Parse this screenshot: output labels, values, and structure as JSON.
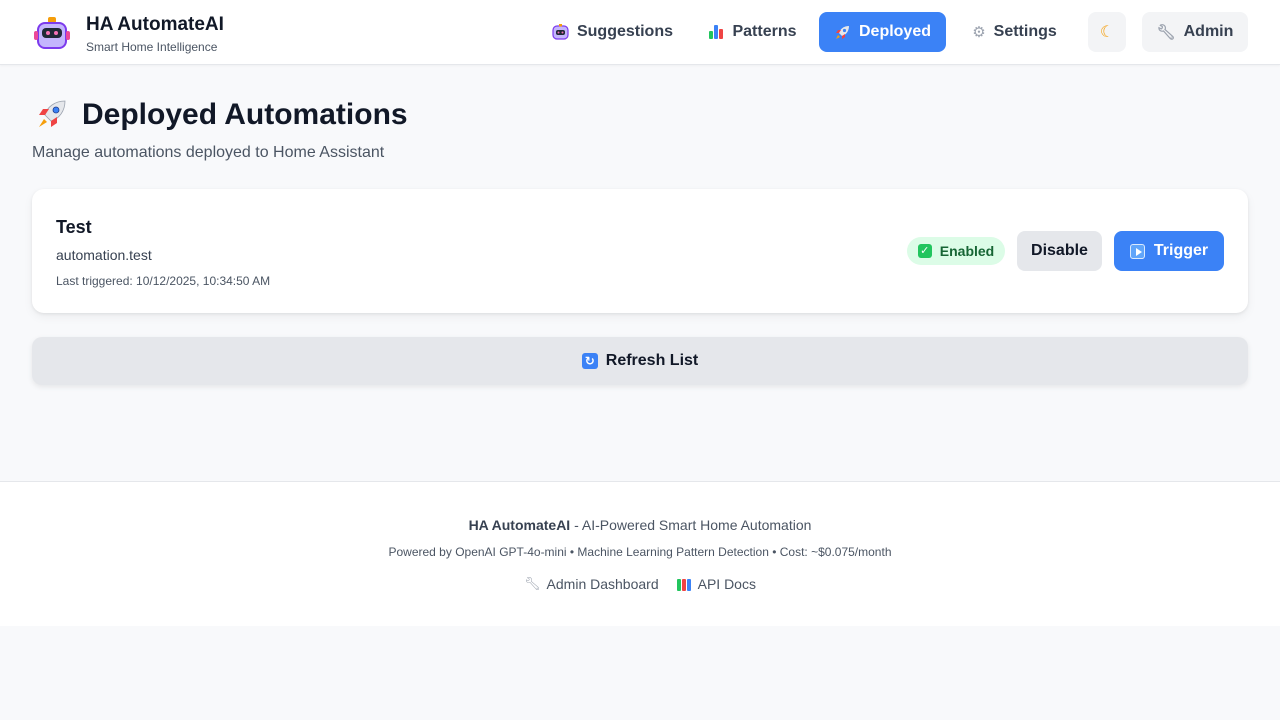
{
  "brand": {
    "title": "HA AutomateAI",
    "subtitle": "Smart Home Intelligence",
    "logo_icon": "robot-icon"
  },
  "nav": {
    "suggestions": {
      "label": "Suggestions",
      "icon": "robot-icon"
    },
    "patterns": {
      "label": "Patterns",
      "icon": "bar-chart-icon"
    },
    "deployed": {
      "label": "Deployed",
      "icon": "rocket-icon",
      "active": true
    },
    "settings": {
      "label": "Settings",
      "icon": "gear-icon"
    },
    "theme_toggle": {
      "icon": "moon-icon"
    },
    "admin": {
      "label": "Admin",
      "icon": "wrench-icon"
    }
  },
  "page": {
    "title": "Deployed Automations",
    "title_icon": "rocket-icon",
    "subtitle": "Manage automations deployed to Home Assistant"
  },
  "automations": [
    {
      "name": "Test",
      "entity_id": "automation.test",
      "last_triggered": "Last triggered: 10/12/2025, 10:34:50 AM",
      "status": "Enabled",
      "disable_label": "Disable",
      "trigger_label": "Trigger"
    }
  ],
  "refresh_label": "Refresh List",
  "footer": {
    "brand": "HA AutomateAI",
    "tagline": " - AI-Powered Smart Home Automation",
    "powered": "Powered by OpenAI GPT-4o-mini • Machine Learning Pattern Detection • Cost: ~$0.075/month",
    "links": {
      "admin": "Admin Dashboard",
      "api": "API Docs"
    }
  },
  "colors": {
    "accent": "#3b82f6",
    "enabled_bg": "#dcfce7",
    "enabled_text": "#166534",
    "background": "#f8f9fb"
  }
}
